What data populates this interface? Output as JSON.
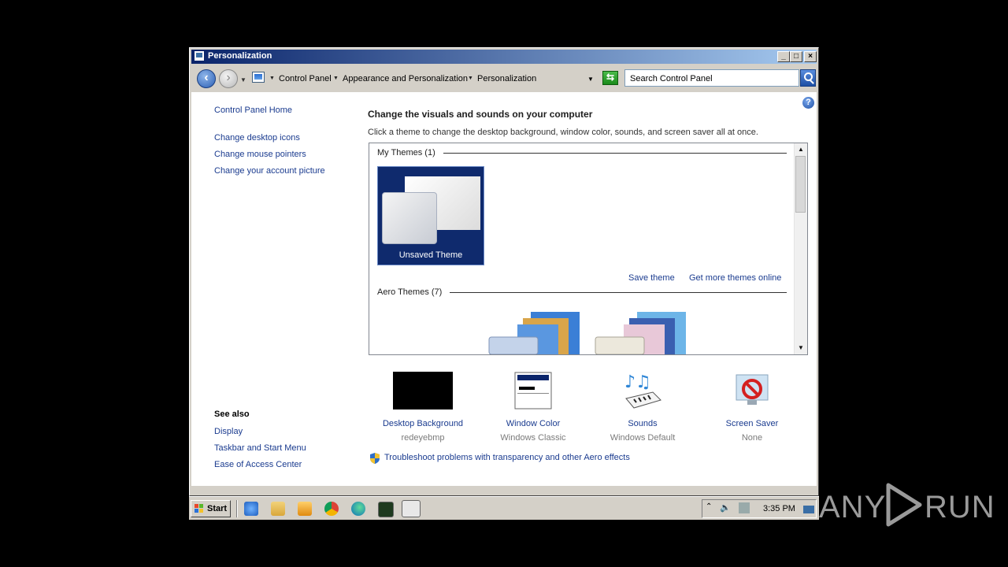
{
  "window": {
    "title": "Personalization",
    "minimize": "_",
    "maximize": "□",
    "close": "×"
  },
  "navbar": {
    "breadcrumbs": [
      "Control Panel",
      "Appearance and Personalization",
      "Personalization"
    ],
    "search_placeholder": "Search Control Panel"
  },
  "left_pane": {
    "home": "Control Panel Home",
    "links": [
      "Change desktop icons",
      "Change mouse pointers",
      "Change your account picture"
    ],
    "see_also_heading": "See also",
    "see_also": [
      "Display",
      "Taskbar and Start Menu",
      "Ease of Access Center"
    ]
  },
  "main": {
    "heading": "Change the visuals and sounds on your computer",
    "subheading": "Click a theme to change the desktop background, window color, sounds, and screen saver all at once.",
    "groups": {
      "my_themes": "My Themes (1)",
      "aero_themes": "Aero Themes (7)"
    },
    "unsaved_theme": "Unsaved Theme",
    "save_theme": "Save theme",
    "get_more_themes": "Get more themes online",
    "items": [
      {
        "label": "Desktop Background",
        "value": "redeyebmp"
      },
      {
        "label": "Window Color",
        "value": "Windows Classic"
      },
      {
        "label": "Sounds",
        "value": "Windows Default"
      },
      {
        "label": "Screen Saver",
        "value": "None"
      }
    ],
    "troubleshoot": "Troubleshoot problems with transparency and other Aero effects"
  },
  "taskbar": {
    "start": "Start",
    "clock": "3:35 PM"
  },
  "watermark": {
    "left": "ANY",
    "right": "RUN"
  },
  "colors": {
    "title_gradient_start": "#0a246a",
    "link": "#1a3b8f",
    "theme_tile": "#0f2a6d"
  }
}
